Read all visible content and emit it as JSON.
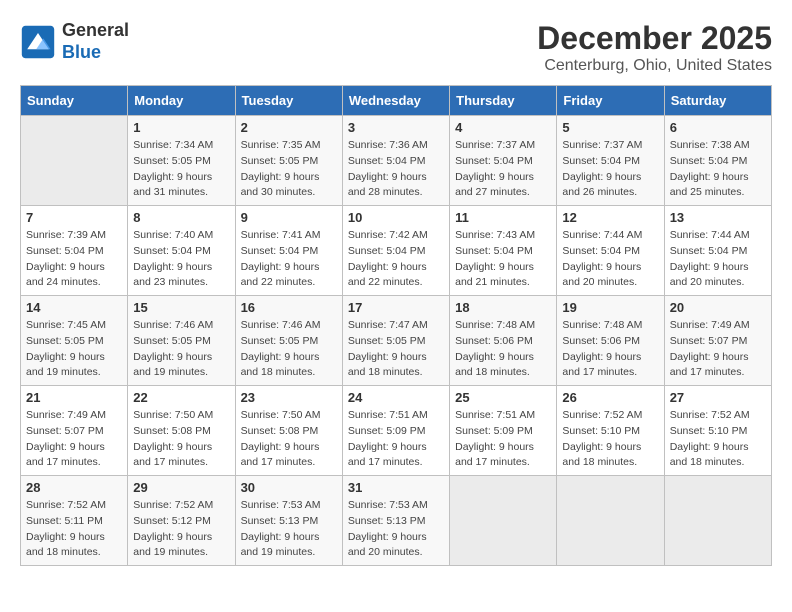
{
  "logo": {
    "line1": "General",
    "line2": "Blue"
  },
  "title": "December 2025",
  "subtitle": "Centerburg, Ohio, United States",
  "days_header": [
    "Sunday",
    "Monday",
    "Tuesday",
    "Wednesday",
    "Thursday",
    "Friday",
    "Saturday"
  ],
  "weeks": [
    [
      {
        "num": "",
        "sunrise": "",
        "sunset": "",
        "daylight": ""
      },
      {
        "num": "1",
        "sunrise": "Sunrise: 7:34 AM",
        "sunset": "Sunset: 5:05 PM",
        "daylight": "Daylight: 9 hours and 31 minutes."
      },
      {
        "num": "2",
        "sunrise": "Sunrise: 7:35 AM",
        "sunset": "Sunset: 5:05 PM",
        "daylight": "Daylight: 9 hours and 30 minutes."
      },
      {
        "num": "3",
        "sunrise": "Sunrise: 7:36 AM",
        "sunset": "Sunset: 5:04 PM",
        "daylight": "Daylight: 9 hours and 28 minutes."
      },
      {
        "num": "4",
        "sunrise": "Sunrise: 7:37 AM",
        "sunset": "Sunset: 5:04 PM",
        "daylight": "Daylight: 9 hours and 27 minutes."
      },
      {
        "num": "5",
        "sunrise": "Sunrise: 7:37 AM",
        "sunset": "Sunset: 5:04 PM",
        "daylight": "Daylight: 9 hours and 26 minutes."
      },
      {
        "num": "6",
        "sunrise": "Sunrise: 7:38 AM",
        "sunset": "Sunset: 5:04 PM",
        "daylight": "Daylight: 9 hours and 25 minutes."
      }
    ],
    [
      {
        "num": "7",
        "sunrise": "Sunrise: 7:39 AM",
        "sunset": "Sunset: 5:04 PM",
        "daylight": "Daylight: 9 hours and 24 minutes."
      },
      {
        "num": "8",
        "sunrise": "Sunrise: 7:40 AM",
        "sunset": "Sunset: 5:04 PM",
        "daylight": "Daylight: 9 hours and 23 minutes."
      },
      {
        "num": "9",
        "sunrise": "Sunrise: 7:41 AM",
        "sunset": "Sunset: 5:04 PM",
        "daylight": "Daylight: 9 hours and 22 minutes."
      },
      {
        "num": "10",
        "sunrise": "Sunrise: 7:42 AM",
        "sunset": "Sunset: 5:04 PM",
        "daylight": "Daylight: 9 hours and 22 minutes."
      },
      {
        "num": "11",
        "sunrise": "Sunrise: 7:43 AM",
        "sunset": "Sunset: 5:04 PM",
        "daylight": "Daylight: 9 hours and 21 minutes."
      },
      {
        "num": "12",
        "sunrise": "Sunrise: 7:44 AM",
        "sunset": "Sunset: 5:04 PM",
        "daylight": "Daylight: 9 hours and 20 minutes."
      },
      {
        "num": "13",
        "sunrise": "Sunrise: 7:44 AM",
        "sunset": "Sunset: 5:04 PM",
        "daylight": "Daylight: 9 hours and 20 minutes."
      }
    ],
    [
      {
        "num": "14",
        "sunrise": "Sunrise: 7:45 AM",
        "sunset": "Sunset: 5:05 PM",
        "daylight": "Daylight: 9 hours and 19 minutes."
      },
      {
        "num": "15",
        "sunrise": "Sunrise: 7:46 AM",
        "sunset": "Sunset: 5:05 PM",
        "daylight": "Daylight: 9 hours and 19 minutes."
      },
      {
        "num": "16",
        "sunrise": "Sunrise: 7:46 AM",
        "sunset": "Sunset: 5:05 PM",
        "daylight": "Daylight: 9 hours and 18 minutes."
      },
      {
        "num": "17",
        "sunrise": "Sunrise: 7:47 AM",
        "sunset": "Sunset: 5:05 PM",
        "daylight": "Daylight: 9 hours and 18 minutes."
      },
      {
        "num": "18",
        "sunrise": "Sunrise: 7:48 AM",
        "sunset": "Sunset: 5:06 PM",
        "daylight": "Daylight: 9 hours and 18 minutes."
      },
      {
        "num": "19",
        "sunrise": "Sunrise: 7:48 AM",
        "sunset": "Sunset: 5:06 PM",
        "daylight": "Daylight: 9 hours and 17 minutes."
      },
      {
        "num": "20",
        "sunrise": "Sunrise: 7:49 AM",
        "sunset": "Sunset: 5:07 PM",
        "daylight": "Daylight: 9 hours and 17 minutes."
      }
    ],
    [
      {
        "num": "21",
        "sunrise": "Sunrise: 7:49 AM",
        "sunset": "Sunset: 5:07 PM",
        "daylight": "Daylight: 9 hours and 17 minutes."
      },
      {
        "num": "22",
        "sunrise": "Sunrise: 7:50 AM",
        "sunset": "Sunset: 5:08 PM",
        "daylight": "Daylight: 9 hours and 17 minutes."
      },
      {
        "num": "23",
        "sunrise": "Sunrise: 7:50 AM",
        "sunset": "Sunset: 5:08 PM",
        "daylight": "Daylight: 9 hours and 17 minutes."
      },
      {
        "num": "24",
        "sunrise": "Sunrise: 7:51 AM",
        "sunset": "Sunset: 5:09 PM",
        "daylight": "Daylight: 9 hours and 17 minutes."
      },
      {
        "num": "25",
        "sunrise": "Sunrise: 7:51 AM",
        "sunset": "Sunset: 5:09 PM",
        "daylight": "Daylight: 9 hours and 17 minutes."
      },
      {
        "num": "26",
        "sunrise": "Sunrise: 7:52 AM",
        "sunset": "Sunset: 5:10 PM",
        "daylight": "Daylight: 9 hours and 18 minutes."
      },
      {
        "num": "27",
        "sunrise": "Sunrise: 7:52 AM",
        "sunset": "Sunset: 5:10 PM",
        "daylight": "Daylight: 9 hours and 18 minutes."
      }
    ],
    [
      {
        "num": "28",
        "sunrise": "Sunrise: 7:52 AM",
        "sunset": "Sunset: 5:11 PM",
        "daylight": "Daylight: 9 hours and 18 minutes."
      },
      {
        "num": "29",
        "sunrise": "Sunrise: 7:52 AM",
        "sunset": "Sunset: 5:12 PM",
        "daylight": "Daylight: 9 hours and 19 minutes."
      },
      {
        "num": "30",
        "sunrise": "Sunrise: 7:53 AM",
        "sunset": "Sunset: 5:13 PM",
        "daylight": "Daylight: 9 hours and 19 minutes."
      },
      {
        "num": "31",
        "sunrise": "Sunrise: 7:53 AM",
        "sunset": "Sunset: 5:13 PM",
        "daylight": "Daylight: 9 hours and 20 minutes."
      },
      {
        "num": "",
        "sunrise": "",
        "sunset": "",
        "daylight": ""
      },
      {
        "num": "",
        "sunrise": "",
        "sunset": "",
        "daylight": ""
      },
      {
        "num": "",
        "sunrise": "",
        "sunset": "",
        "daylight": ""
      }
    ]
  ]
}
